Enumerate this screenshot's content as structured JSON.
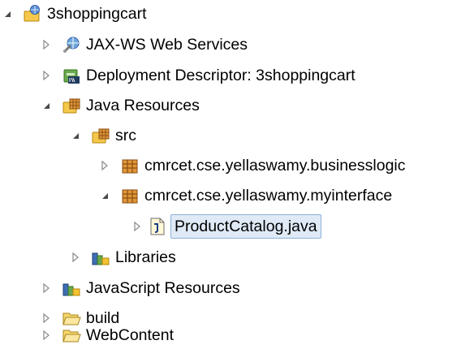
{
  "explorer": {
    "items": [
      {
        "label": "3shoppingcart",
        "icon": "web-project-icon",
        "state": "expanded"
      },
      {
        "label": "JAX-WS Web Services",
        "icon": "web-services-icon",
        "state": "collapsed"
      },
      {
        "label": "Deployment Descriptor: 3shoppingcart",
        "icon": "deployment-descriptor-icon",
        "state": "collapsed"
      },
      {
        "label": "Java Resources",
        "icon": "java-resources-icon",
        "state": "expanded"
      },
      {
        "label": "src",
        "icon": "source-folder-icon",
        "state": "expanded"
      },
      {
        "label": "cmrcet.cse.yellaswamy.businesslogic",
        "icon": "package-icon",
        "state": "collapsed"
      },
      {
        "label": "cmrcet.cse.yellaswamy.myinterface",
        "icon": "package-icon",
        "state": "expanded"
      },
      {
        "label": "ProductCatalog.java",
        "icon": "java-file-icon",
        "state": "collapsed",
        "selected": true
      },
      {
        "label": "Libraries",
        "icon": "libraries-icon",
        "state": "collapsed"
      },
      {
        "label": "JavaScript Resources",
        "icon": "javascript-resources-icon",
        "state": "collapsed"
      },
      {
        "label": "build",
        "icon": "folder-icon",
        "state": "collapsed"
      },
      {
        "label": "WebContent",
        "icon": "folder-icon",
        "state": "collapsed"
      }
    ]
  },
  "colors": {
    "selection_bg": "#dfeaf6",
    "selection_border": "#8fb0d8",
    "package_brown": "#b8722c",
    "folder_yellow": "#f2c94c"
  }
}
